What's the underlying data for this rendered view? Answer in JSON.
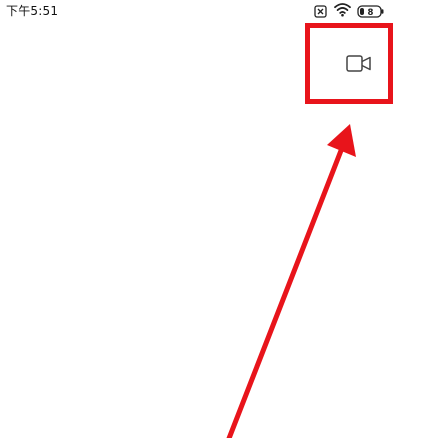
{
  "status_bar": {
    "time": "下午5:51",
    "battery_level": "8",
    "icons": [
      "sim-absent-icon",
      "wifi-icon",
      "battery-icon"
    ]
  },
  "toolbar": {
    "camera_icon": "video-camera-icon"
  },
  "annotation": {
    "highlight_color": "#e8141b",
    "arrow_color": "#e8141b",
    "target": "camera-button"
  }
}
